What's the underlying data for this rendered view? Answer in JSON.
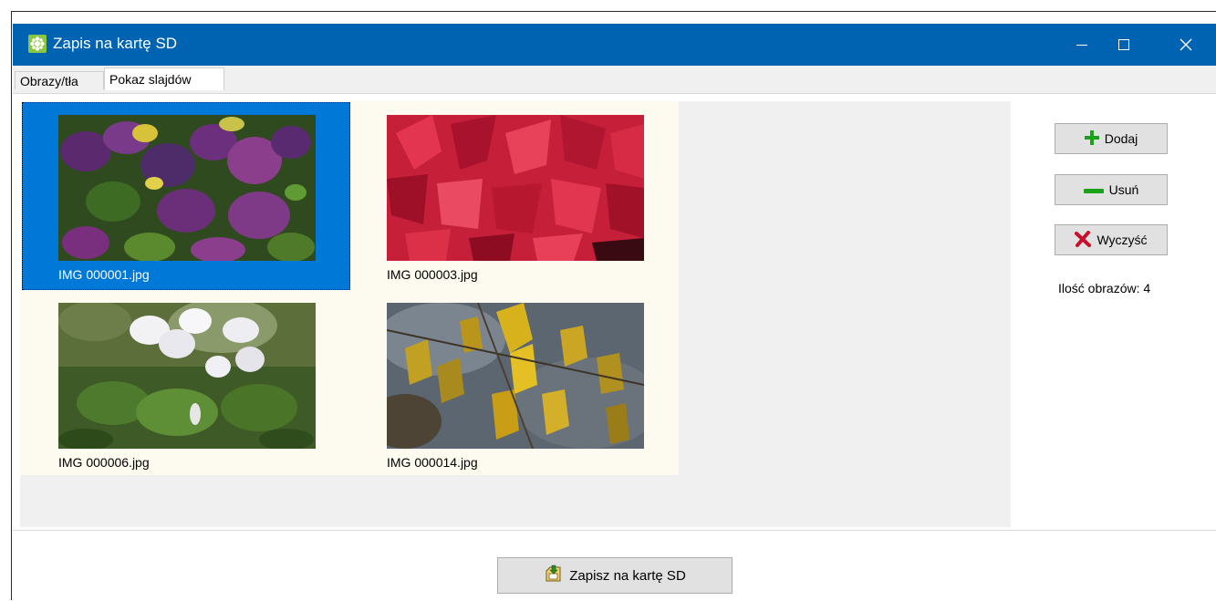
{
  "window": {
    "title": "Zapis na kartę SD",
    "app_icon": "sd-card-app-icon",
    "controls": {
      "minimize": "minimize-icon",
      "maximize": "maximize-icon",
      "close": "close-icon"
    }
  },
  "tabs": [
    {
      "label": "Obrazy/tła",
      "active": false
    },
    {
      "label": "Pokaz slajdów",
      "active": true
    }
  ],
  "images": [
    {
      "filename": "IMG 000001.jpg",
      "selected": true,
      "picture": "purple-leaves-photo"
    },
    {
      "filename": "IMG 000003.jpg",
      "selected": false,
      "picture": "red-leaves-photo"
    },
    {
      "filename": "IMG 000006.jpg",
      "selected": false,
      "picture": "white-flowers-photo"
    },
    {
      "filename": "IMG 000014.jpg",
      "selected": false,
      "picture": "yellow-leaves-photo"
    }
  ],
  "side_panel": {
    "add_label": "Dodaj",
    "add_icon": "plus-icon",
    "remove_label": "Usuń",
    "remove_icon": "minus-icon",
    "clear_label": "Wyczyść",
    "clear_icon": "x-mark-icon",
    "count_text": "Ilość obrazów: 4"
  },
  "footer": {
    "save_label": "Zapisz na kartę SD",
    "save_icon": "save-to-sd-icon"
  },
  "colors": {
    "titlebar": "#0063b1",
    "selection": "#0078d7",
    "add_green": "#1aa21a",
    "clear_red": "#c8102e"
  }
}
